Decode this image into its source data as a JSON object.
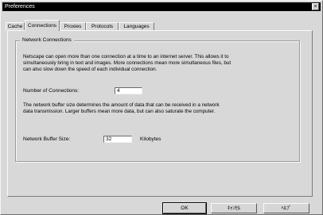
{
  "window": {
    "title": "Preferences",
    "close_glyph": "×"
  },
  "tabs": [
    {
      "label": "Cache"
    },
    {
      "label": "Connections",
      "active": true
    },
    {
      "label": "Proxies"
    },
    {
      "label": "Protocols"
    },
    {
      "label": "Languages"
    }
  ],
  "group": {
    "label": "Network Connections",
    "intro_line1": "Netscape can open more than one connection at a time to an internet server.  This allows it to",
    "intro_line2": "simultaneously bring in text and images.  More connections mean more simultaneous files, but",
    "intro_line3": "can also slow down the speed of each individual connection.",
    "connections_label": "Number of Connections:",
    "connections_value": "4",
    "buffer_line1": "The network buffer size determines the amount of data that can be received in a network",
    "buffer_line2": "data transmission.  Larger buffers mean more data, but can also saturate the computer.",
    "buffer_label": "Network Buffer Size:",
    "buffer_value": "32",
    "buffer_unit": "Kilobytes"
  },
  "buttons": {
    "ok": "OK",
    "cancel": "ｷｬﾝｾﾙ",
    "help": "ﾍﾙﾌﾟ"
  }
}
